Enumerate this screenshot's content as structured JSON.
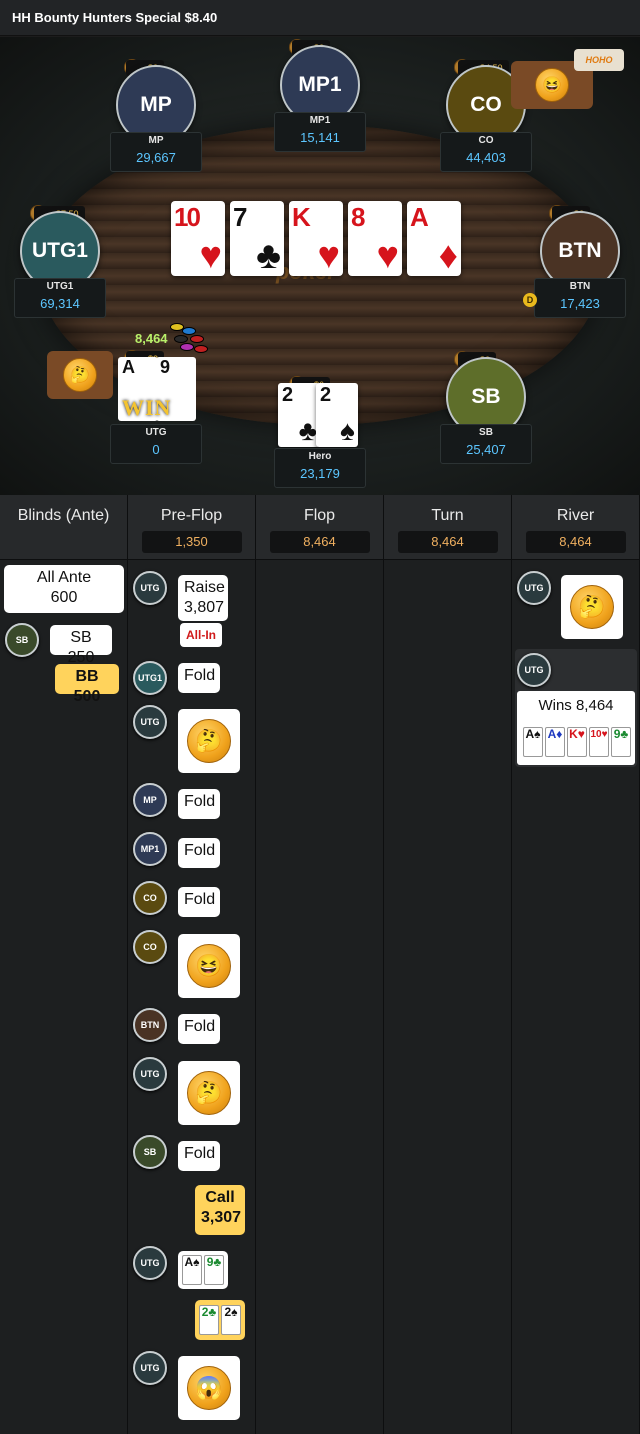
{
  "header": {
    "title": "HH  Bounty Hunters Special $8.40"
  },
  "table": {
    "brand": "poker",
    "pot": "8,464",
    "win_text": "WIN",
    "dealer_label": "D",
    "seats": [
      {
        "pos": "MP",
        "name": "MP",
        "stack": "29,667",
        "bounty": "$3",
        "color": "#2e3a55"
      },
      {
        "pos": "MP1",
        "name": "MP1",
        "stack": "15,141",
        "bounty": "$2",
        "color": "#2e3a55"
      },
      {
        "pos": "CO",
        "name": "CO",
        "stack": "44,403",
        "bounty": "$4.50",
        "color": "#5a4a10"
      },
      {
        "pos": "UTG1",
        "name": "UTG1",
        "stack": "69,314",
        "bounty": "$7.50",
        "color": "#2a5a5e"
      },
      {
        "pos": "BTN",
        "name": "BTN",
        "stack": "17,423",
        "bounty": "$2",
        "color": "#4a3324"
      },
      {
        "pos": "SB",
        "name": "SB",
        "stack": "25,407",
        "bounty": "$2",
        "color": "#5e6e2a"
      },
      {
        "pos": "UTG",
        "name": "UTG",
        "stack": "0",
        "bounty": "$3",
        "color": "#2a3a3e"
      },
      {
        "pos": "Hero",
        "name": "Hero",
        "stack": "23,179",
        "bounty": "$6",
        "color": "#2a3a3e"
      }
    ],
    "board": [
      {
        "rank": "10",
        "suit": "♥",
        "color": "red"
      },
      {
        "rank": "7",
        "suit": "♣",
        "color": "black"
      },
      {
        "rank": "K",
        "suit": "♥",
        "color": "red"
      },
      {
        "rank": "8",
        "suit": "♥",
        "color": "red"
      },
      {
        "rank": "A",
        "suit": "♦",
        "color": "red"
      }
    ],
    "hero_cards": [
      {
        "rank": "2",
        "suit": "♣"
      },
      {
        "rank": "2",
        "suit": "♠"
      }
    ],
    "utg_cards": [
      {
        "rank": "A",
        "suit": "♠"
      },
      {
        "rank": "9",
        "suit": "♣"
      }
    ]
  },
  "history": {
    "columns": [
      {
        "title": "Blinds (Ante)",
        "pot": ""
      },
      {
        "title": "Pre-Flop",
        "pot": "1,350"
      },
      {
        "title": "Flop",
        "pot": "8,464"
      },
      {
        "title": "Turn",
        "pot": "8,464"
      },
      {
        "title": "River",
        "pot": "8,464"
      }
    ],
    "blinds": {
      "ante_line1": "All Ante",
      "ante_line2": "600",
      "sb_badge": "SB",
      "sb_text": "SB  250",
      "bb_text": "BB  500"
    },
    "preflop": [
      {
        "badge": "UTG",
        "line1": "Raise",
        "line2": "3,807",
        "extra": "All-In"
      },
      {
        "badge": "UTG1",
        "text": "Fold"
      },
      {
        "badge": "UTG",
        "emoji": "thinking"
      },
      {
        "badge": "MP",
        "text": "Fold"
      },
      {
        "badge": "MP1",
        "text": "Fold"
      },
      {
        "badge": "CO",
        "text": "Fold"
      },
      {
        "badge": "CO",
        "emoji": "laughing"
      },
      {
        "badge": "BTN",
        "text": "Fold"
      },
      {
        "badge": "UTG",
        "emoji": "thinking"
      },
      {
        "badge": "SB",
        "text": "Fold"
      },
      {
        "hero_line1": "Call",
        "hero_line2": "3,307"
      },
      {
        "badge": "UTG",
        "cards": [
          "A♠",
          "9♣"
        ]
      },
      {
        "hero_cards": [
          "2♣",
          "2♠"
        ]
      },
      {
        "badge": "UTG",
        "emoji": "shocked"
      }
    ],
    "river": {
      "badge1": "UTG",
      "emoji": "thinking",
      "badge2": "UTG",
      "wins_text": "Wins 8,464",
      "cards": [
        "A♠",
        "A♦",
        "K♥",
        "10♥",
        "9♣"
      ]
    }
  }
}
